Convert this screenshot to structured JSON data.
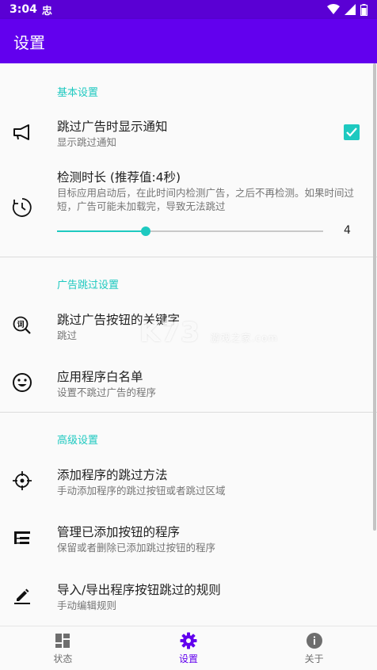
{
  "statusbar": {
    "time": "3:04",
    "notif_glyph": "忠"
  },
  "appbar": {
    "title": "设置"
  },
  "sections": {
    "basic": "基本设置",
    "adskip": "广告跳过设置",
    "advanced": "高级设置"
  },
  "items": {
    "show_notice": {
      "title": "跳过广告时显示通知",
      "sub": "显示跳过通知",
      "checked": true
    },
    "duration": {
      "title": "检测时长 (推荐值:4秒)",
      "sub": "目标应用启动后，在此时间内检测广告，之后不再检测。如果时间过短，广告可能未加载完，导致无法跳过",
      "value": "4",
      "fraction": 0.333
    },
    "keywords": {
      "title": "跳过广告按钮的关键字",
      "sub": "跳过"
    },
    "whitelist": {
      "title": "应用程序白名单",
      "sub": "设置不跳过广告的程序"
    },
    "add_method": {
      "title": "添加程序的跳过方法",
      "sub": "手动添加程序的跳过按钮或者跳过区域"
    },
    "manage": {
      "title": "管理已添加按钮的程序",
      "sub": "保留或者删除已添加跳过按钮的程序"
    },
    "import_export": {
      "title": "导入/导出程序按钮跳过的规则",
      "sub": "手动编辑规则"
    }
  },
  "watermark": {
    "main": "K73",
    "small": "游戏之家",
    "domain": ".com"
  },
  "bottomnav": [
    {
      "label": "状态",
      "icon": "dashboard-icon",
      "active": false
    },
    {
      "label": "设置",
      "icon": "gear-icon",
      "active": true
    },
    {
      "label": "关于",
      "icon": "info-icon",
      "active": false
    }
  ],
  "colors": {
    "primary": "#6200ee",
    "statusbar": "#5a00d4",
    "accent": "#1ec9c0"
  }
}
